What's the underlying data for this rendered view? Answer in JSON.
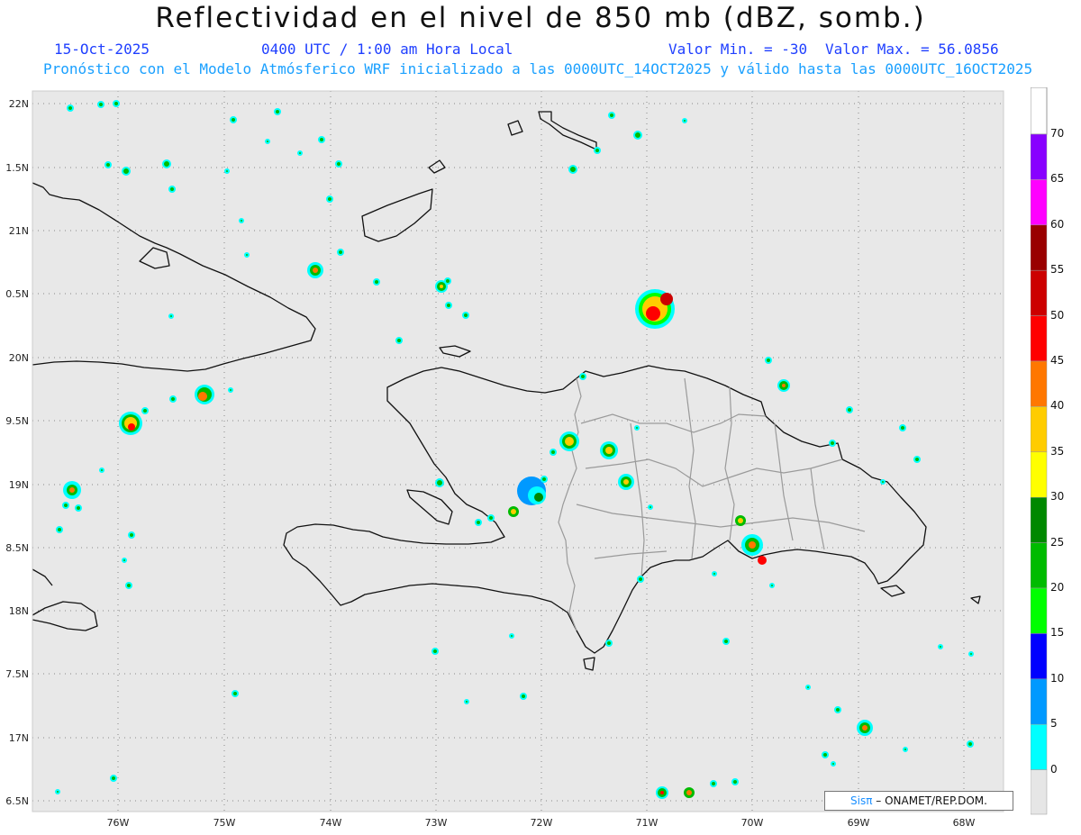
{
  "title": "Reflectividad en el nivel de 850 mb (dBZ, somb.)",
  "date": "15-Oct-2025",
  "time": "0400 UTC / 1:00 am Hora Local",
  "min_label": "Valor Min. = -30",
  "max_label": "Valor Max. = 56.0856",
  "model_info": "Pronóstico con el Modelo Atmósferico WRF inicializado a las 0000UTC_14OCT2025 y válido hasta las  0000UTC_16OCT2025",
  "credit": {
    "logo": "Sisπ",
    "text": " – ONAMET/REP.DOM."
  },
  "lat_labels": [
    "22N",
    "1.5N",
    "21N",
    "0.5N",
    "20N",
    "9.5N",
    "19N",
    "8.5N",
    "18N",
    "7.5N",
    "17N",
    "6.5N"
  ],
  "lon_labels": [
    "76W",
    "75W",
    "74W",
    "73W",
    "72W",
    "71W",
    "70W",
    "69W",
    "68W"
  ],
  "colorbar": {
    "labels": [
      "70",
      "65",
      "60",
      "55",
      "50",
      "45",
      "40",
      "35",
      "30",
      "25",
      "20",
      "15",
      "10",
      "5",
      "0"
    ],
    "colors": [
      "#8800ff",
      "#ff00ff",
      "#990000",
      "#cc0000",
      "#ff0000",
      "#ff7700",
      "#ffcc00",
      "#ffff00",
      "#008800",
      "#00bb00",
      "#00ff00",
      "#0000ff",
      "#0099ff",
      "#00ffff",
      "#e6e6e6"
    ]
  }
}
